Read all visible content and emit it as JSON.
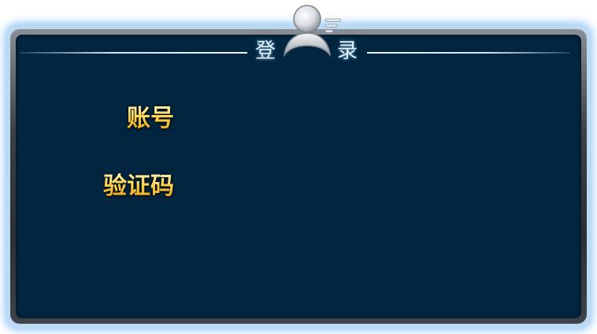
{
  "title": {
    "left_char": "登",
    "right_char": "录"
  },
  "form": {
    "account_label": "账号",
    "code_label": "验证码"
  },
  "colors": {
    "panel_background": "#022640",
    "label_gold": "#f5c032",
    "title_text": "#e8f4fc",
    "frame_glow": "#bcdaf3"
  },
  "icons": {
    "header": "user-avatar-icon"
  }
}
